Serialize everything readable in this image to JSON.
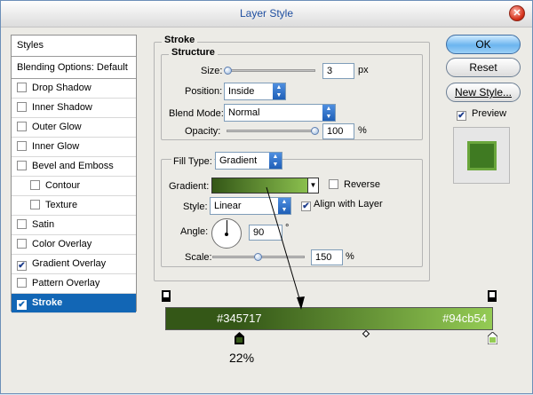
{
  "window": {
    "title": "Layer Style"
  },
  "styles_list": {
    "header": "Styles",
    "blending": "Blending Options: Default",
    "items": [
      {
        "label": "Drop Shadow",
        "checked": false,
        "sub": false,
        "selected": false
      },
      {
        "label": "Inner Shadow",
        "checked": false,
        "sub": false,
        "selected": false
      },
      {
        "label": "Outer Glow",
        "checked": false,
        "sub": false,
        "selected": false
      },
      {
        "label": "Inner Glow",
        "checked": false,
        "sub": false,
        "selected": false
      },
      {
        "label": "Bevel and Emboss",
        "checked": false,
        "sub": false,
        "selected": false
      },
      {
        "label": "Contour",
        "checked": false,
        "sub": true,
        "selected": false
      },
      {
        "label": "Texture",
        "checked": false,
        "sub": true,
        "selected": false
      },
      {
        "label": "Satin",
        "checked": false,
        "sub": false,
        "selected": false
      },
      {
        "label": "Color Overlay",
        "checked": false,
        "sub": false,
        "selected": false
      },
      {
        "label": "Gradient Overlay",
        "checked": true,
        "sub": false,
        "selected": false
      },
      {
        "label": "Pattern Overlay",
        "checked": false,
        "sub": false,
        "selected": false
      },
      {
        "label": "Stroke",
        "checked": true,
        "sub": false,
        "selected": true
      }
    ]
  },
  "buttons": {
    "ok": "OK",
    "reset": "Reset",
    "new_style": "New Style..."
  },
  "preview": {
    "label": "Preview",
    "checked": true
  },
  "stroke": {
    "title": "Stroke",
    "structure": {
      "title": "Structure",
      "size_label": "Size:",
      "size_value": "3",
      "size_unit": "px",
      "size_fraction": 0.02,
      "position_label": "Position:",
      "position_value": "Inside",
      "blend_label": "Blend Mode:",
      "blend_value": "Normal",
      "opacity_label": "Opacity:",
      "opacity_value": "100",
      "opacity_unit": "%",
      "opacity_fraction": 1.0
    },
    "fill": {
      "fill_type_label": "Fill Type:",
      "fill_type_value": "Gradient",
      "gradient_label": "Gradient:",
      "reverse_label": "Reverse",
      "reverse_checked": false,
      "style_label": "Style:",
      "style_value": "Linear",
      "align_label": "Align with Layer",
      "align_checked": true,
      "angle_label": "Angle:",
      "angle_value": "90",
      "angle_unit": "°",
      "scale_label": "Scale:",
      "scale_value": "150",
      "scale_unit": "%",
      "scale_fraction": 0.5
    }
  },
  "gradient_editor": {
    "start_color_label": "#345717",
    "end_color_label": "#94cb54",
    "start_stop_location": "22%",
    "colors": {
      "start": "#345717",
      "end": "#94cb54"
    }
  }
}
